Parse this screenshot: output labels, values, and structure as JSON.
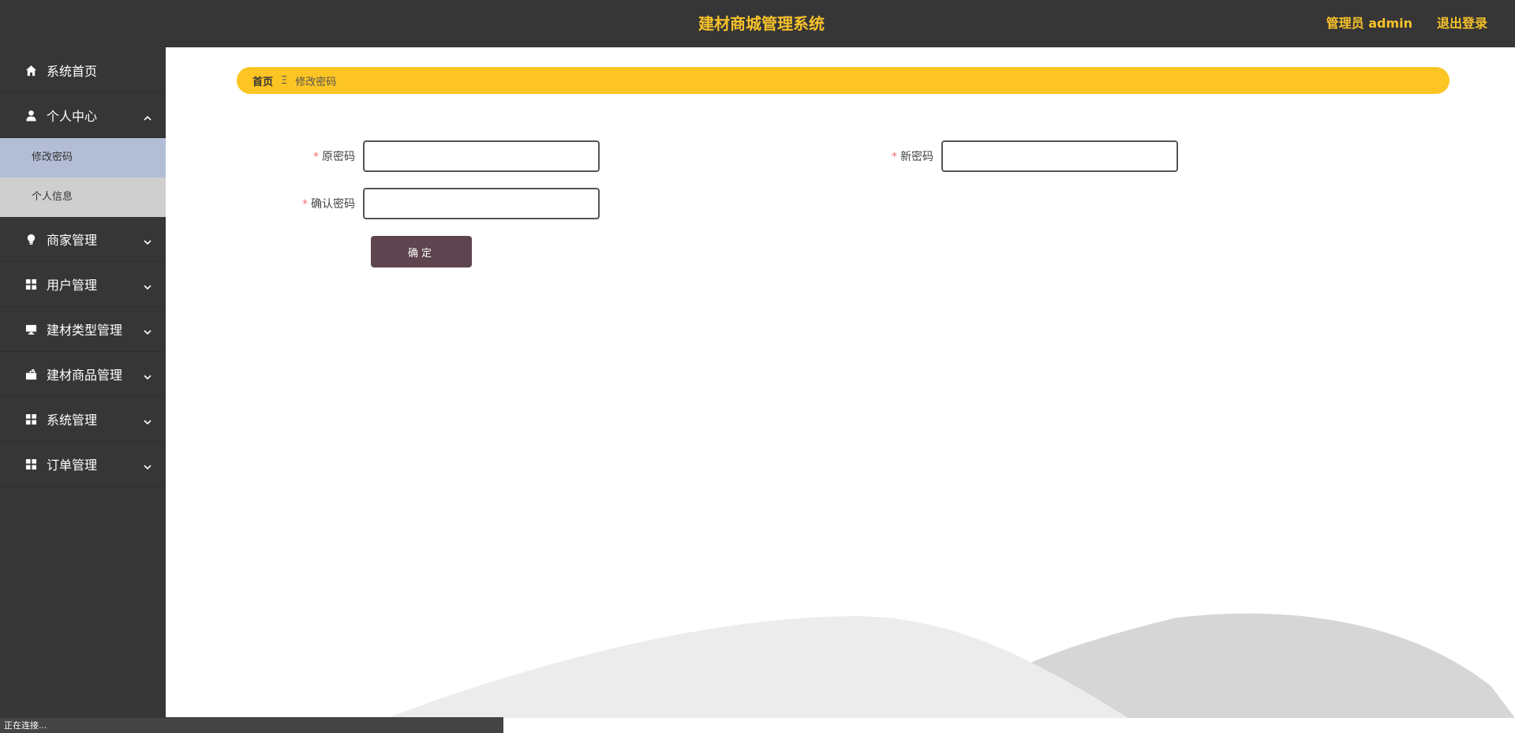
{
  "header": {
    "title": "建材商城管理系统",
    "user_label": "管理员 admin",
    "logout_label": "退出登录"
  },
  "sidebar": {
    "items": [
      {
        "label": "系统首页",
        "icon": "home-icon"
      },
      {
        "label": "个人中心",
        "icon": "user-icon",
        "expanded": true,
        "children": [
          {
            "label": "修改密码",
            "active": true
          },
          {
            "label": "个人信息",
            "active": false
          }
        ]
      },
      {
        "label": "商家管理",
        "icon": "bulb-icon"
      },
      {
        "label": "用户管理",
        "icon": "grid-icon"
      },
      {
        "label": "建材类型管理",
        "icon": "monitor-icon"
      },
      {
        "label": "建材商品管理",
        "icon": "toolbox-icon"
      },
      {
        "label": "系统管理",
        "icon": "grid-icon"
      },
      {
        "label": "订单管理",
        "icon": "grid-icon"
      }
    ]
  },
  "breadcrumb": {
    "home": "首页",
    "separator": "Ξ",
    "current": "修改密码"
  },
  "form": {
    "required_mark": "*",
    "old_password_label": "原密码",
    "old_password_value": "",
    "new_password_label": "新密码",
    "new_password_value": "",
    "confirm_password_label": "确认密码",
    "confirm_password_value": "",
    "submit_label": "确定"
  },
  "status_bar": {
    "text": "正在连接..."
  },
  "colors": {
    "accent": "#f6c12a",
    "header_bg": "#363636",
    "breadcrumb_bg": "#fcc523",
    "button_bg": "#5d444f",
    "submenu_active_bg": "#b3bed6"
  }
}
